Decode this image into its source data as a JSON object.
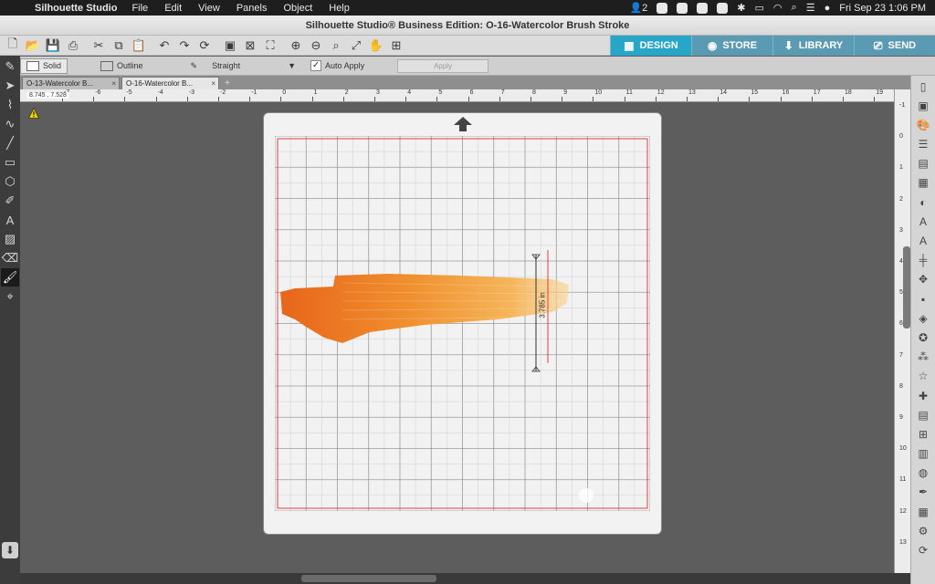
{
  "menubar": {
    "app_name": "Silhouette Studio",
    "menus": [
      "File",
      "Edit",
      "View",
      "Panels",
      "Object",
      "Help"
    ],
    "notification_count": "2",
    "clock": "Fri Sep 23  1:06 PM"
  },
  "window": {
    "title": "Silhouette Studio® Business Edition: O-16-Watercolor Brush Stroke"
  },
  "toolbar": {
    "tools": [
      "new-doc-icon",
      "open-icon",
      "save-icon",
      "print-icon",
      "cut-icon",
      "copy-icon",
      "paste-icon",
      "undo-icon",
      "redo-icon",
      "refresh-icon",
      "group-icon",
      "ungroup-icon",
      "select-all-icon",
      "zoom-in-icon",
      "zoom-out-icon",
      "zoom-select-icon",
      "zoom-fit-icon",
      "pan-icon",
      "fit-page-icon"
    ]
  },
  "nav_tabs": [
    {
      "label": "DESIGN",
      "icon": "grid-icon",
      "active": true
    },
    {
      "label": "STORE",
      "icon": "store-icon",
      "active": false
    },
    {
      "label": "LIBRARY",
      "icon": "library-icon",
      "active": false
    },
    {
      "label": "SEND",
      "icon": "send-icon",
      "active": false
    }
  ],
  "options": {
    "solid_label": "Solid",
    "outline_label": "Outline",
    "straight_label": "Straight",
    "auto_apply_label": "Auto Apply",
    "apply_label": "Apply"
  },
  "doc_tabs": [
    {
      "label": "O-13-Watercolor B...",
      "active": false
    },
    {
      "label": "O-16-Watercolor B...",
      "active": true
    }
  ],
  "coords_readout": "8.745 , 7.528",
  "ruler_h_labels": [
    "-7",
    "-6",
    "-5",
    "-4",
    "-3",
    "-2",
    "-1",
    "0",
    "1",
    "2",
    "3",
    "4",
    "5",
    "6",
    "7",
    "8",
    "9",
    "10",
    "11",
    "12",
    "13",
    "14",
    "15",
    "16",
    "17",
    "18",
    "19"
  ],
  "ruler_v_labels": [
    "-1",
    "0",
    "1",
    "2",
    "3",
    "4",
    "5",
    "6",
    "7",
    "8",
    "9",
    "10",
    "11",
    "12",
    "13"
  ],
  "dimension_label": "3.785 in",
  "colors": {
    "accent": "#28a6c8",
    "stroke_dark": "#e8651a",
    "stroke_light": "#f7c77a",
    "cut_line": "#e04040"
  }
}
